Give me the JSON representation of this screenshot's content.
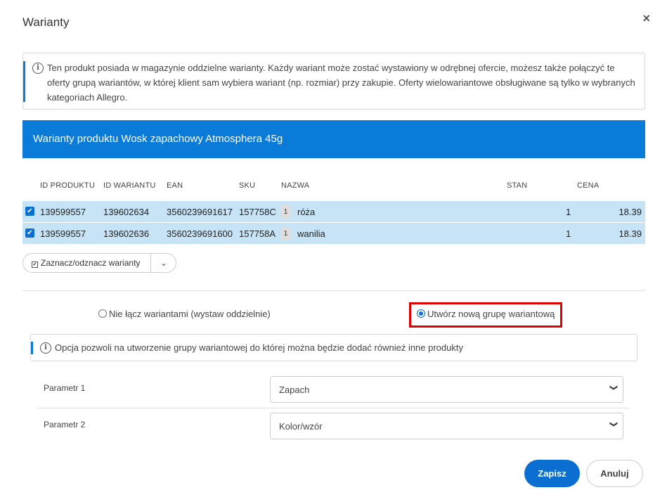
{
  "modal": {
    "title": "Warianty",
    "close_label": "×"
  },
  "info": {
    "icon": "info-icon",
    "text": "Ten produkt posiada w magazynie oddzielne warianty. Każdy wariant może zostać wystawiony w odrębnej ofercie, możesz także połączyć te oferty grupą wariantów, w której klient sam wybiera wariant (np. rozmiar) przy zakupie. Oferty wielowariantowe obsługiwane są tylko w wybranych kategoriach Allegro."
  },
  "variants_header": "Warianty produktu Wosk zapachowy Atmosphera 45g",
  "table": {
    "columns": {
      "id_produktu": "ID PRODUKTU",
      "id_wariantu": "ID WARIANTU",
      "ean": "EAN",
      "sku": "SKU",
      "nazwa": "NAZWA",
      "stan": "STAN",
      "cena": "CENA"
    },
    "rows": [
      {
        "checked": true,
        "id_produktu": "139599557",
        "id_wariantu": "139602634",
        "ean": "3560239691617",
        "sku": "157758C",
        "qty": "1",
        "nazwa": "róża",
        "stan": "1",
        "cena": "18.39"
      },
      {
        "checked": true,
        "id_produktu": "139599557",
        "id_wariantu": "139602636",
        "ean": "3560239691600",
        "sku": "157758A",
        "qty": "1",
        "nazwa": "wanilia",
        "stan": "1",
        "cena": "18.39"
      }
    ]
  },
  "toggle_button": {
    "label": "Zaznacz/odznacz warianty",
    "caret": "⌄"
  },
  "grouping": {
    "option_separate": "Nie łącz wariantami (wystaw oddzielnie)",
    "option_new_group": "Utwórz nową grupę wariantową",
    "selected": "option_new_group",
    "hint": "Opcja pozwoli na utworzenie grupy wariantowej do której można będzie dodać również inne produkty"
  },
  "params": [
    {
      "label": "Parametr 1",
      "value": "Zapach"
    },
    {
      "label": "Parametr 2",
      "value": "Kolor/wzór"
    }
  ],
  "footer": {
    "save": "Zapisz",
    "cancel": "Anuluj"
  },
  "colors": {
    "accent": "#0a7bd9",
    "row_selected": "#c7e4f7",
    "highlight_border": "#e00000"
  }
}
